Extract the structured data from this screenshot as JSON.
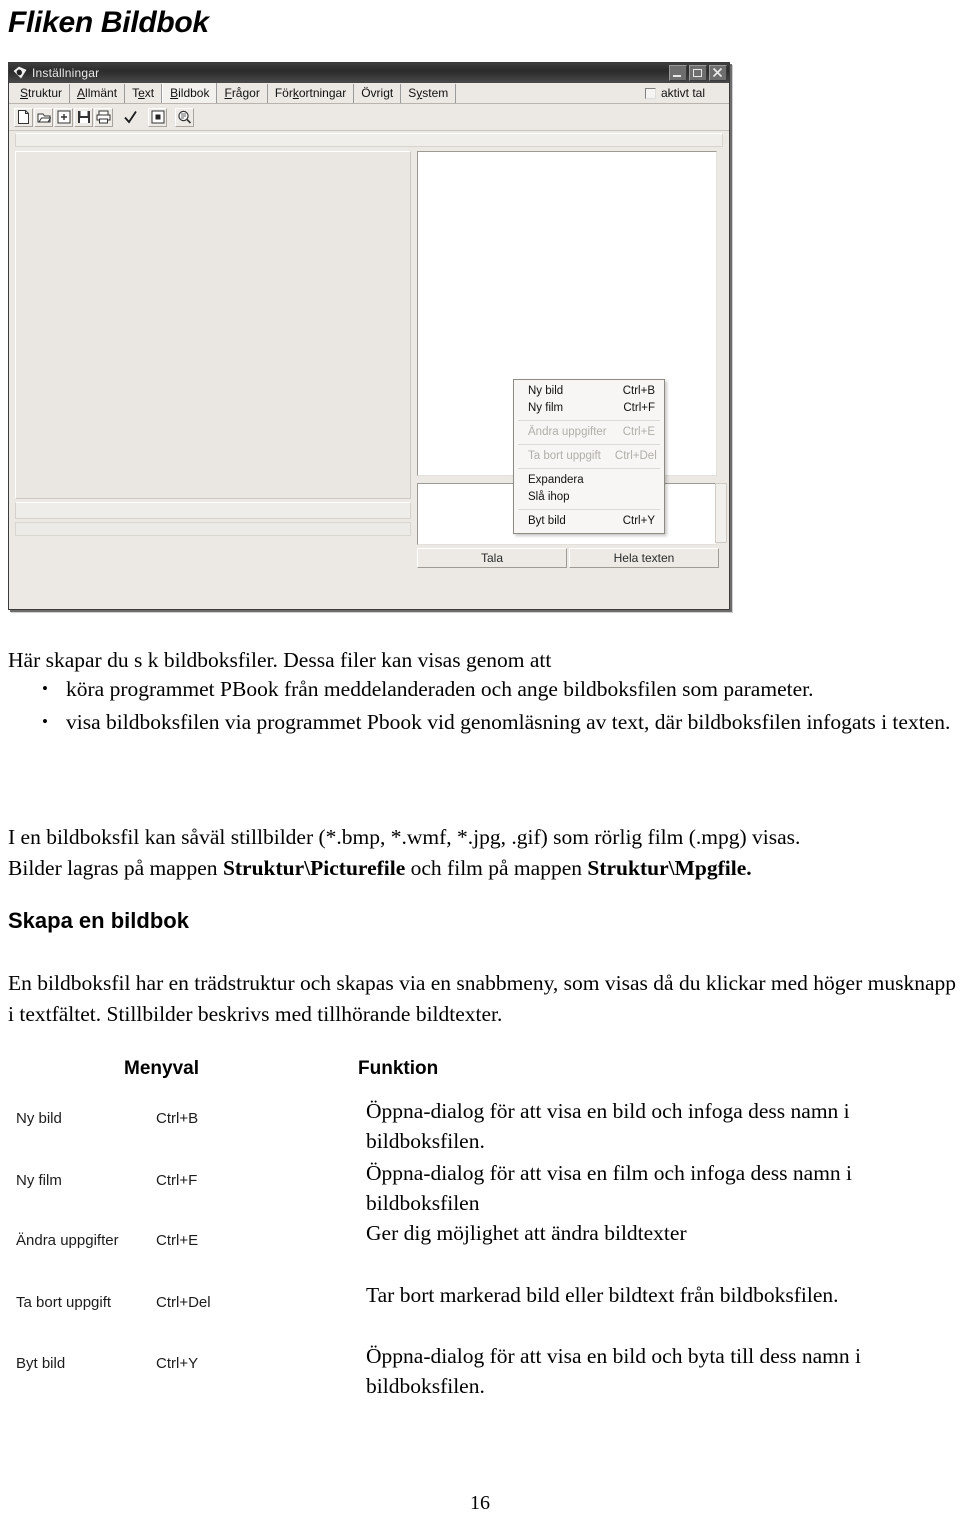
{
  "page": {
    "heading": "Fliken Bildbok",
    "number": "16"
  },
  "dialog": {
    "title": "Inställningar",
    "title_icon": "gem-icon",
    "window_buttons": {
      "minimize": "minimize-icon",
      "maximize": "maximize-icon",
      "close": "close-icon"
    },
    "tabs": [
      {
        "label": "Struktur",
        "accel": "S",
        "active": false
      },
      {
        "label": "Allmänt",
        "accel": "A",
        "active": false
      },
      {
        "label": "Text",
        "accel": "e",
        "active": false
      },
      {
        "label": "Bildbok",
        "accel": "B",
        "active": true
      },
      {
        "label": "Frågor",
        "accel": "F",
        "active": false
      },
      {
        "label": "Förkortningar",
        "accel": "k",
        "active": false
      },
      {
        "label": "Övrigt",
        "accel": "",
        "active": false
      },
      {
        "label": "System",
        "accel": "y",
        "active": false
      }
    ],
    "checkbox": {
      "label": "aktivt tal",
      "checked": false
    },
    "toolbar": [
      "new-document-icon",
      "open-folder-icon",
      "save-as-icon",
      "save-icon",
      "print-icon",
      "check-icon",
      "stop-icon",
      "preview-icon"
    ],
    "buttons": {
      "tala": "Tala",
      "hela_texten": "Hela texten"
    },
    "context_menu": [
      {
        "label": "Ny bild",
        "key": "Ctrl+B",
        "disabled": false,
        "separator_after": false
      },
      {
        "label": "Ny film",
        "key": "Ctrl+F",
        "disabled": false,
        "separator_after": true
      },
      {
        "label": "Ändra uppgifter",
        "key": "Ctrl+E",
        "disabled": true,
        "separator_after": true
      },
      {
        "label": "Ta bort uppgift",
        "key": "Ctrl+Del",
        "disabled": true,
        "separator_after": true
      },
      {
        "label": "Expandera",
        "key": "",
        "disabled": false,
        "separator_after": false
      },
      {
        "label": "Slå ihop",
        "key": "",
        "disabled": false,
        "separator_after": true
      },
      {
        "label": "Byt bild",
        "key": "Ctrl+Y",
        "disabled": false,
        "separator_after": false
      }
    ]
  },
  "content": {
    "intro": "Här skapar du s k bildboksfiler. Dessa filer kan visas genom att",
    "bullets": [
      "köra programmet PBook från meddelanderaden och ange bildboksfilen som parameter.",
      "visa bildboksfilen via programmet Pbook vid genomläsning av text, där bildboksfilen infogats i texten."
    ],
    "formats_line1": "I en bildboksfil kan såväl stillbilder (*.bmp, *.wmf, *.jpg, .gif) som rörlig film (.mpg) visas.",
    "formats_line2_pre": "Bilder lagras på mappen ",
    "formats_folder_pictures": "Struktur\\Picturefile",
    "formats_line2_mid": " och film på mappen ",
    "formats_folder_mpg": "Struktur\\Mpgfile.",
    "section_heading": "Skapa en bildbok",
    "tree_paragraph": "En bildboksfil har en trädstruktur och skapas via en snabbmeny, som visas då du klickar med höger musknapp i textfältet. Stillbilder beskrivs med tillhörande bildtexter."
  },
  "table": {
    "header_menyval": "Menyval",
    "header_funktion": "Funktion",
    "rows": [
      {
        "menu": "Ny bild",
        "key": "Ctrl+B",
        "desc": "Öppna-dialog för att visa en bild och infoga dess namn i bildboksfilen."
      },
      {
        "menu": "Ny film",
        "key": "Ctrl+F",
        "desc": "Öppna-dialog för att visa en film och infoga dess namn i bildboksfilen"
      },
      {
        "menu": "Ändra uppgifter",
        "key": "Ctrl+E",
        "desc": "Ger dig möjlighet att ändra bildtexter"
      },
      {
        "menu": "Ta bort uppgift",
        "key": "Ctrl+Del",
        "desc": "Tar bort markerad bild eller bildtext från bildboksfilen."
      },
      {
        "menu": "Byt bild",
        "key": "Ctrl+Y",
        "desc": "Öppna-dialog för att visa en bild och byta till dess namn i bildboksfilen."
      }
    ]
  }
}
